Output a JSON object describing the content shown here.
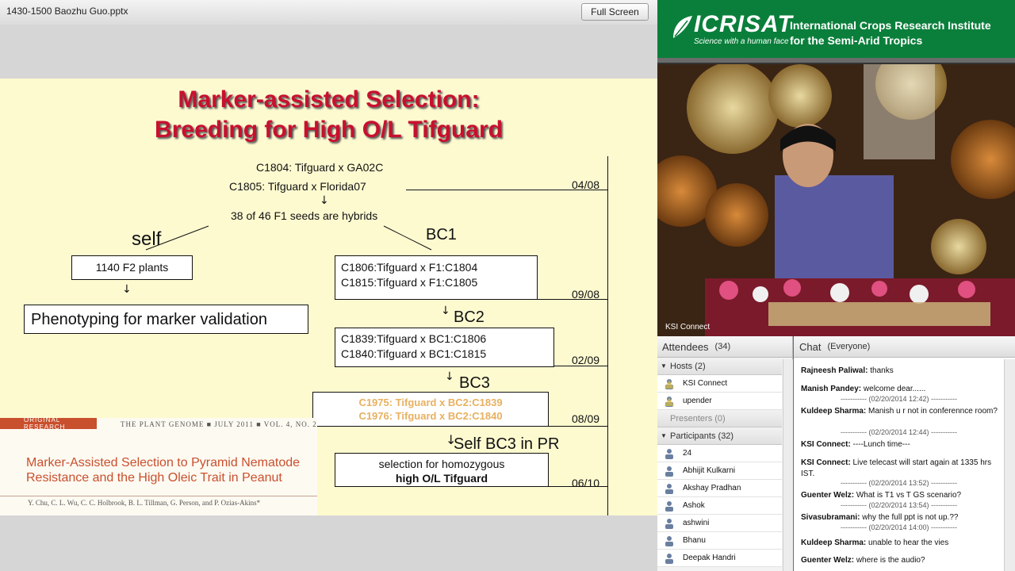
{
  "window": {
    "title": "1430-1500  Baozhu Guo.pptx",
    "fullscreen_label": "Full Screen"
  },
  "slide": {
    "title_line1": "Marker-assisted Selection:",
    "title_line2": "Breeding for High O/L Tifguard",
    "cross1": "C1804: Tifguard x GA02C",
    "cross2": "C1805: Tifguard x Florida07",
    "hybrids": "38 of 46 F1 seeds are hybrids",
    "self_label": "self",
    "bc1_label": "BC1",
    "bc2_label": "BC2",
    "bc3_label": "BC3",
    "self_bc3_label": "Self BC3 in PR",
    "f2_box": "1140 F2 plants",
    "phenotyping_box": "Phenotyping for marker validation",
    "bc1_box": [
      "C1806:Tifguard x F1:C1804",
      "C1815:Tifguard x F1:C1805"
    ],
    "bc2_box": [
      "C1839:Tifguard x BC1:C1806",
      "C1840:Tifguard x BC1:C1815"
    ],
    "bc3_box": [
      "C1975: Tifguard x BC2:C1839",
      "C1976: Tifguard x BC2:C1840"
    ],
    "final_box_line1": "selection for homozygous",
    "final_box_line2": "high O/L Tifguard",
    "dates": [
      "04/08",
      "09/08",
      "02/09",
      "08/09",
      "06/10"
    ],
    "paper": {
      "header": "ORIGINAL RESEARCH",
      "journal": "THE PLANT GENOME ■ JULY 2011 ■ VOL. 4, NO. 2",
      "title": "Marker-Assisted Selection to Pyramid Nematode Resistance and the High Oleic Trait in Peanut",
      "authors": "Y. Chu, C. L. Wu, C. C. Holbrook, B. L. Tillman, G. Person, and P. Ozias-Akins*"
    },
    "colors": {
      "title": "#c8102e",
      "background": "#fdfad0",
      "bc3_text": "#e8b060"
    }
  },
  "brand": {
    "logo": "ICRISAT",
    "tagline": "Science with a human face",
    "org_line1": "International Crops Research Institute",
    "org_line2": "for the Semi-Arid Tropics",
    "color": "#0a7f3b"
  },
  "video": {
    "label": "KSI Connect"
  },
  "attendees": {
    "title": "Attendees",
    "count": "(34)",
    "hosts_label": "Hosts (2)",
    "hosts": [
      "KSI Connect",
      "upender"
    ],
    "presenters_label": "Presenters (0)",
    "participants_label": "Participants (32)",
    "participants": [
      "24",
      "Abhijit Kulkarni",
      "Akshay Pradhan",
      "Ashok",
      "ashwini",
      "Bhanu",
      "Deepak Handri"
    ]
  },
  "chat": {
    "title": "Chat",
    "scope": "(Everyone)",
    "items": [
      {
        "kind": "msg",
        "sender": "Rajneesh Paliwal:",
        "text": " thanks"
      },
      {
        "kind": "msg",
        "sender": "Manish Pandey:",
        "text": " welcome dear......"
      },
      {
        "kind": "ts",
        "text": "----------- (02/20/2014 12:42) -----------"
      },
      {
        "kind": "msg",
        "sender": "Kuldeep Sharma:",
        "text": " Manish u r not in conferennce room?"
      },
      {
        "kind": "ts",
        "text": "----------- (02/20/2014 12:44) -----------"
      },
      {
        "kind": "msg",
        "sender": "KSI Connect:",
        "text": " ----Lunch time---"
      },
      {
        "kind": "msg",
        "sender": "KSI Connect:",
        "text": " Live telecast will start again at 1335 hrs IST."
      },
      {
        "kind": "ts",
        "text": "----------- (02/20/2014 13:52) -----------"
      },
      {
        "kind": "msg",
        "sender": "Guenter Welz:",
        "text": " What is T1 vs T GS scenario?"
      },
      {
        "kind": "ts",
        "text": "----------- (02/20/2014 13:54) -----------"
      },
      {
        "kind": "msg",
        "sender": "Sivasubramani:",
        "text": " why the full ppt is not up.??"
      },
      {
        "kind": "ts",
        "text": "----------- (02/20/2014 14:00) -----------"
      },
      {
        "kind": "msg",
        "sender": "Kuldeep Sharma:",
        "text": " unable to hear the vies"
      },
      {
        "kind": "msg",
        "sender": "Guenter Welz:",
        "text": " where is the audio?"
      }
    ]
  }
}
